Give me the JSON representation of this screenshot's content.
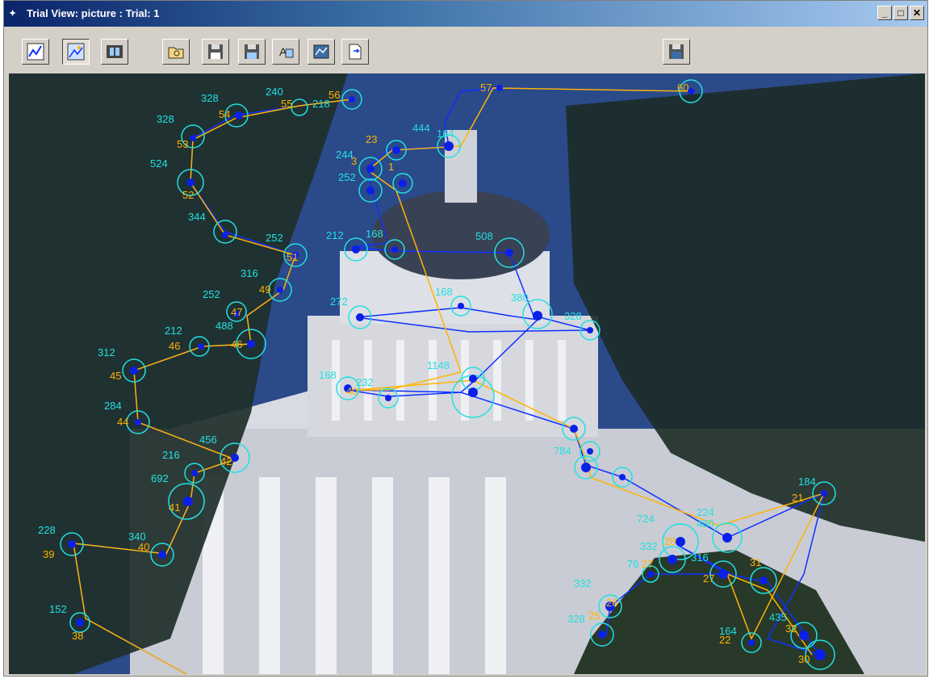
{
  "window": {
    "title": "Trial View: picture : Trial: 1",
    "app_icon": "eye-trace-icon",
    "controls": {
      "minimize": "_",
      "maximize": "□",
      "close": "✕"
    }
  },
  "toolbar": {
    "buttons": [
      {
        "name": "line-graph-icon",
        "pressed": false
      },
      {
        "name": "image-view-icon",
        "pressed": true
      },
      {
        "name": "film-strip-icon",
        "pressed": false
      },
      {
        "name": "open-folder-icon",
        "pressed": false
      },
      {
        "name": "save-disk-icon",
        "pressed": false
      },
      {
        "name": "save-disk-2-icon",
        "pressed": false
      },
      {
        "name": "text-font-icon",
        "pressed": false
      },
      {
        "name": "picture-export-icon",
        "pressed": false
      },
      {
        "name": "document-export-icon",
        "pressed": false
      },
      {
        "name": "save-image-icon",
        "pressed": false
      }
    ]
  },
  "colors": {
    "saccade": "#ffb400",
    "path": "#1030ff",
    "fixation_ring": "#22e0e0",
    "fixation_dot": "#0a20e8"
  },
  "labels": {
    "durations": [
      "328",
      "240",
      "218",
      "328",
      "524",
      "344",
      "252",
      "316",
      "252",
      "488",
      "212",
      "312",
      "284",
      "456",
      "216",
      "692",
      "228",
      "340",
      "152",
      "444",
      "164",
      "244",
      "252",
      "212",
      "168",
      "508",
      "272",
      "168",
      "380",
      "328",
      "168",
      "232",
      "1148",
      "784",
      "184",
      "724",
      "224",
      "480",
      "332",
      "316",
      "76",
      "332",
      "328",
      "164",
      "435"
    ],
    "indices": [
      "56",
      "55",
      "54",
      "53",
      "52",
      "51",
      "49",
      "46",
      "47",
      "46",
      "45",
      "44",
      "42",
      "41",
      "40",
      "39",
      "38",
      "57",
      "58",
      "60",
      "23",
      "1",
      "3",
      "10",
      "40",
      "21",
      "28",
      "27",
      "25",
      "26",
      "22",
      "31",
      "32",
      "30"
    ]
  }
}
